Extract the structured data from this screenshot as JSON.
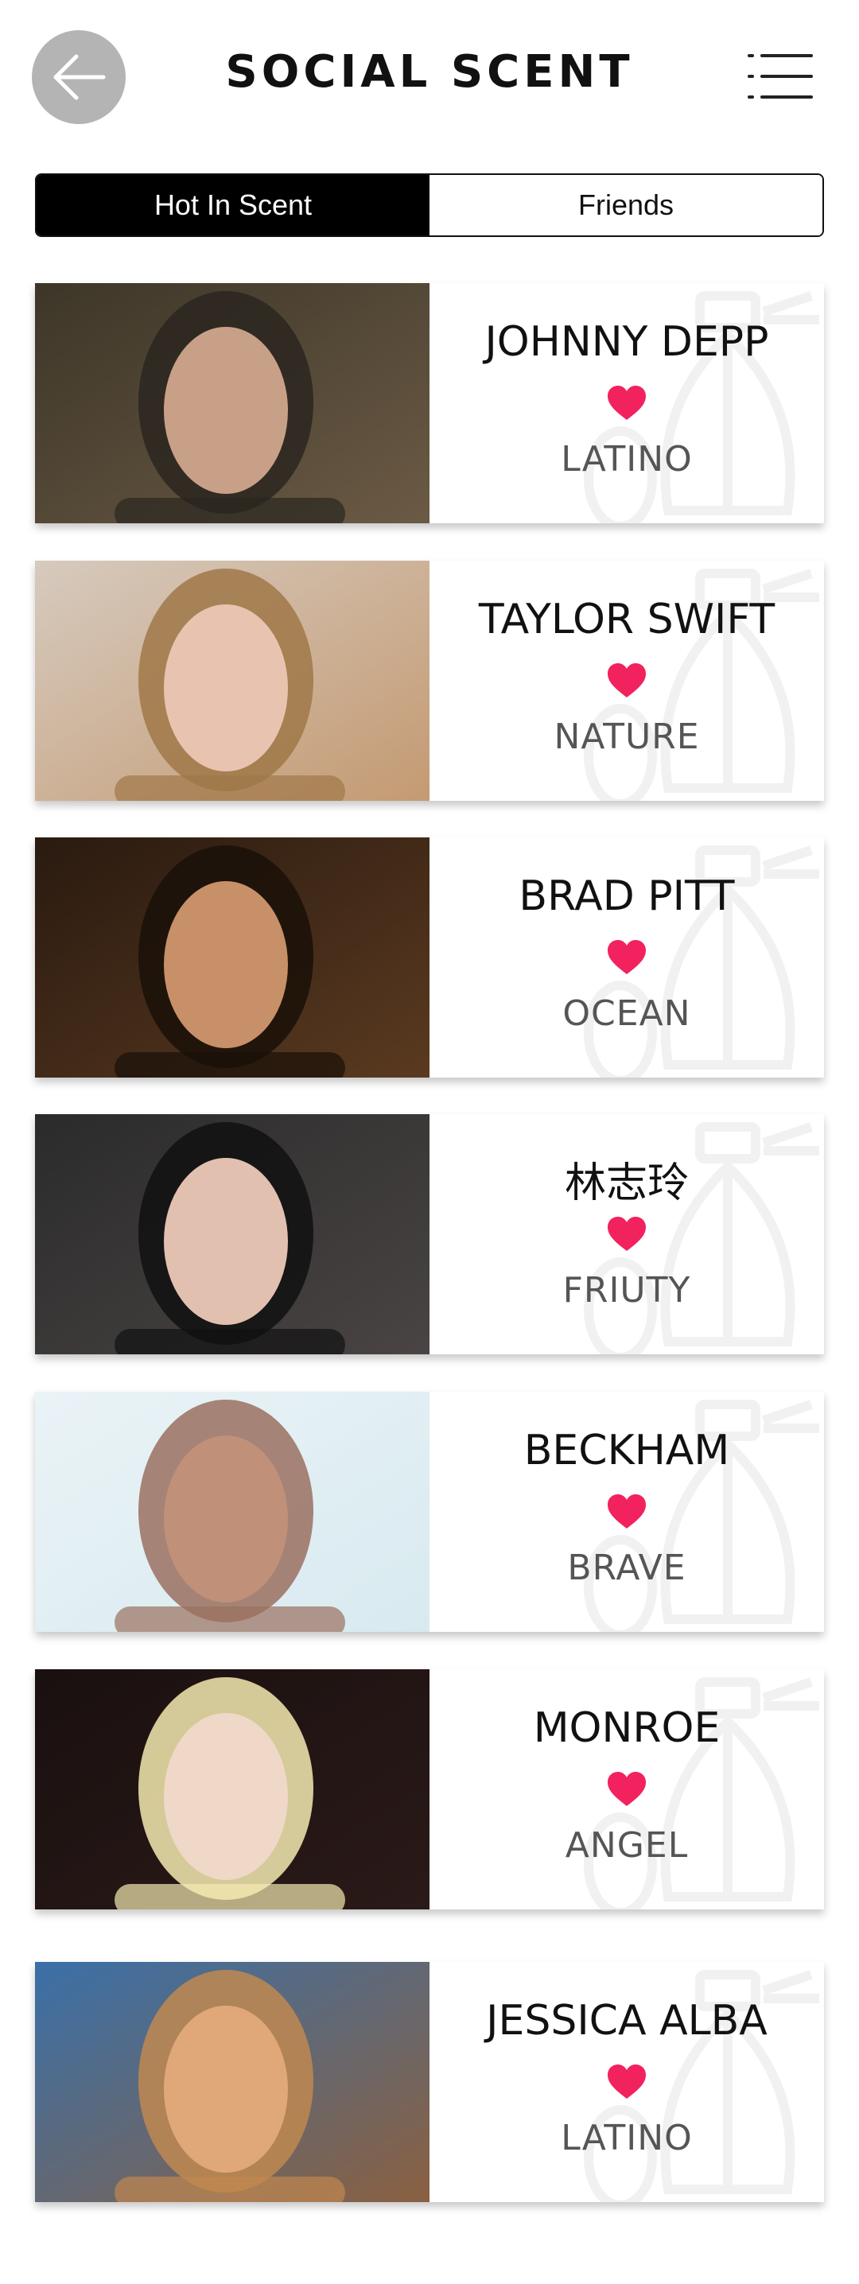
{
  "header": {
    "title": "SOCIAL SCENT",
    "back_icon": "back-arrow-icon",
    "menu_icon": "hamburger-menu-icon"
  },
  "tabs": [
    {
      "label": "Hot In Scent",
      "active": true
    },
    {
      "label": "Friends",
      "active": false
    }
  ],
  "colors": {
    "heart": "#f2225e",
    "tab_active_bg": "#000000",
    "back_button": "#b4b4b4"
  },
  "celebrities": [
    {
      "name": "JOHNNY DEPP",
      "scent": "LATINO"
    },
    {
      "name": "TAYLOR SWIFT",
      "scent": "NATURE"
    },
    {
      "name": "BRAD PITT",
      "scent": "OCEAN"
    },
    {
      "name": "林志玲",
      "scent": "FRIUTY"
    },
    {
      "name": "BECKHAM",
      "scent": "BRAVE"
    },
    {
      "name": "MONROE",
      "scent": "ANGEL"
    },
    {
      "name": "JESSICA ALBA",
      "scent": "LATINO"
    }
  ]
}
